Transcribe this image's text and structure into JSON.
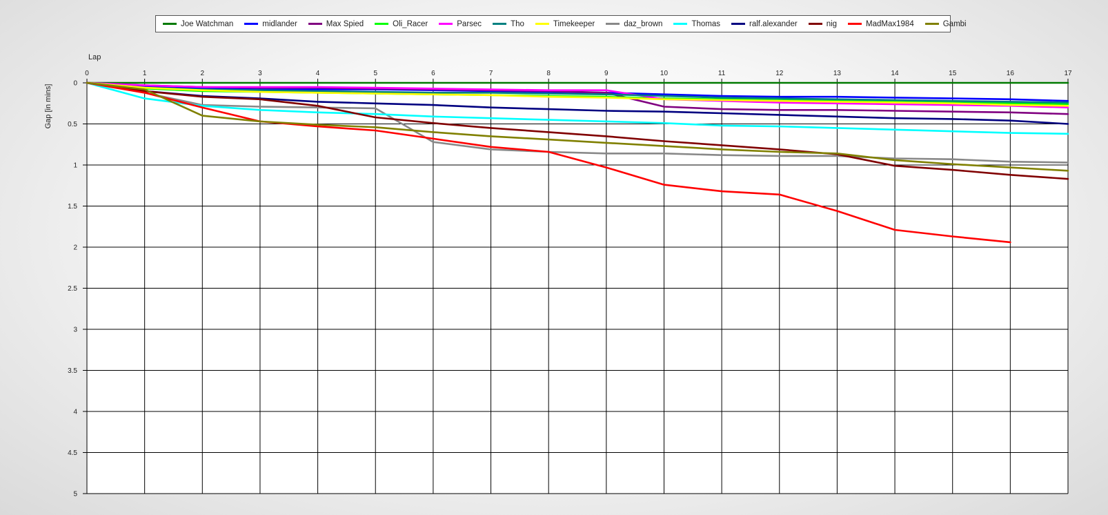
{
  "chart_data": {
    "type": "line",
    "title": "",
    "xlabel": "Lap",
    "ylabel": "Gap [in mins]",
    "xlim": [
      0,
      17
    ],
    "ylim": [
      0,
      5
    ],
    "y_inverted": true,
    "grid": true,
    "legend_position": "top",
    "x_ticks": [
      "0",
      "1",
      "2",
      "3",
      "4",
      "5",
      "6",
      "7",
      "8",
      "9",
      "10",
      "11",
      "12",
      "13",
      "14",
      "15",
      "16",
      "17"
    ],
    "y_ticks": [
      "0",
      "0.5",
      "1",
      "1.5",
      "2",
      "2.5",
      "3",
      "3.5",
      "4",
      "4.5",
      "5"
    ],
    "x": [
      0,
      1,
      2,
      3,
      4,
      5,
      6,
      7,
      8,
      9,
      10,
      11,
      12,
      13,
      14,
      15,
      16,
      17
    ],
    "series": [
      {
        "name": "Joe Watchman",
        "color": "#007a00",
        "values": [
          0,
          0,
          0,
          0,
          0,
          0,
          0,
          0,
          0,
          0,
          0,
          0,
          0,
          0,
          0,
          0,
          0,
          0
        ]
      },
      {
        "name": "midlander",
        "color": "#0000ff",
        "values": [
          0,
          0.05,
          0.07,
          0.08,
          0.08,
          0.08,
          0.09,
          0.1,
          0.11,
          0.12,
          0.14,
          0.16,
          0.17,
          0.17,
          0.18,
          0.19,
          0.2,
          0.22
        ]
      },
      {
        "name": "Max Spied",
        "color": "#800080",
        "values": [
          0,
          0.03,
          0.05,
          0.06,
          0.06,
          0.07,
          0.08,
          0.09,
          0.1,
          0.12,
          0.29,
          0.32,
          0.33,
          0.33,
          0.34,
          0.35,
          0.36,
          0.38
        ]
      },
      {
        "name": "Oli_Racer",
        "color": "#00ff00",
        "values": [
          0,
          0.07,
          0.1,
          0.11,
          0.12,
          0.13,
          0.14,
          0.15,
          0.16,
          0.17,
          0.19,
          0.2,
          0.21,
          0.22,
          0.23,
          0.24,
          0.25,
          0.26
        ]
      },
      {
        "name": "Parsec",
        "color": "#ff00ff",
        "values": [
          0,
          0.03,
          0.05,
          0.05,
          0.05,
          0.06,
          0.07,
          0.08,
          0.09,
          0.09,
          0.2,
          0.22,
          0.24,
          0.25,
          0.26,
          0.27,
          0.28,
          0.3
        ]
      },
      {
        "name": "Tho",
        "color": "#008080",
        "values": [
          0,
          0.06,
          0.08,
          0.09,
          0.1,
          0.11,
          0.12,
          0.12,
          0.13,
          0.14,
          0.16,
          0.18,
          0.19,
          0.2,
          0.21,
          0.22,
          0.23,
          0.24
        ]
      },
      {
        "name": "Timekeeper",
        "color": "#ffff00",
        "values": [
          0,
          0.06,
          0.09,
          0.11,
          0.12,
          0.13,
          0.14,
          0.15,
          0.17,
          0.18,
          0.2,
          0.21,
          0.22,
          0.23,
          0.24,
          0.25,
          0.27,
          0.28
        ]
      },
      {
        "name": "daz_brown",
        "color": "#888888",
        "values": [
          0,
          0.12,
          0.27,
          0.29,
          0.3,
          0.31,
          0.72,
          0.81,
          0.84,
          0.86,
          0.86,
          0.88,
          0.89,
          0.89,
          0.92,
          0.93,
          0.96,
          0.97
        ]
      },
      {
        "name": "Thomas",
        "color": "#00ffff",
        "values": [
          0,
          0.19,
          0.28,
          0.33,
          0.36,
          0.38,
          0.41,
          0.43,
          0.45,
          0.47,
          0.49,
          0.52,
          0.53,
          0.55,
          0.57,
          0.59,
          0.61,
          0.62
        ]
      },
      {
        "name": "ralf.alexander",
        "color": "#000080",
        "values": [
          0,
          0.1,
          0.16,
          0.19,
          0.23,
          0.25,
          0.27,
          0.3,
          0.32,
          0.34,
          0.35,
          0.37,
          0.39,
          0.41,
          0.43,
          0.44,
          0.46,
          0.5
        ]
      },
      {
        "name": "nig",
        "color": "#800000",
        "values": [
          0,
          0.1,
          0.17,
          0.2,
          0.28,
          0.42,
          0.49,
          0.55,
          0.6,
          0.65,
          0.71,
          0.76,
          0.81,
          0.87,
          1.01,
          1.06,
          1.12,
          1.17
        ]
      },
      {
        "name": "MadMax1984",
        "color": "#ff0000",
        "values": [
          0,
          0.12,
          0.3,
          0.47,
          0.53,
          0.58,
          0.68,
          0.78,
          0.84,
          1.03,
          1.24,
          1.32,
          1.36,
          1.56,
          1.79,
          1.87,
          1.94,
          null
        ]
      },
      {
        "name": "Gambi",
        "color": "#808000",
        "values": [
          0,
          0.08,
          0.4,
          0.47,
          0.51,
          0.54,
          0.6,
          0.65,
          0.69,
          0.73,
          0.77,
          0.81,
          0.84,
          0.86,
          0.94,
          0.99,
          1.03,
          1.07
        ]
      }
    ]
  }
}
